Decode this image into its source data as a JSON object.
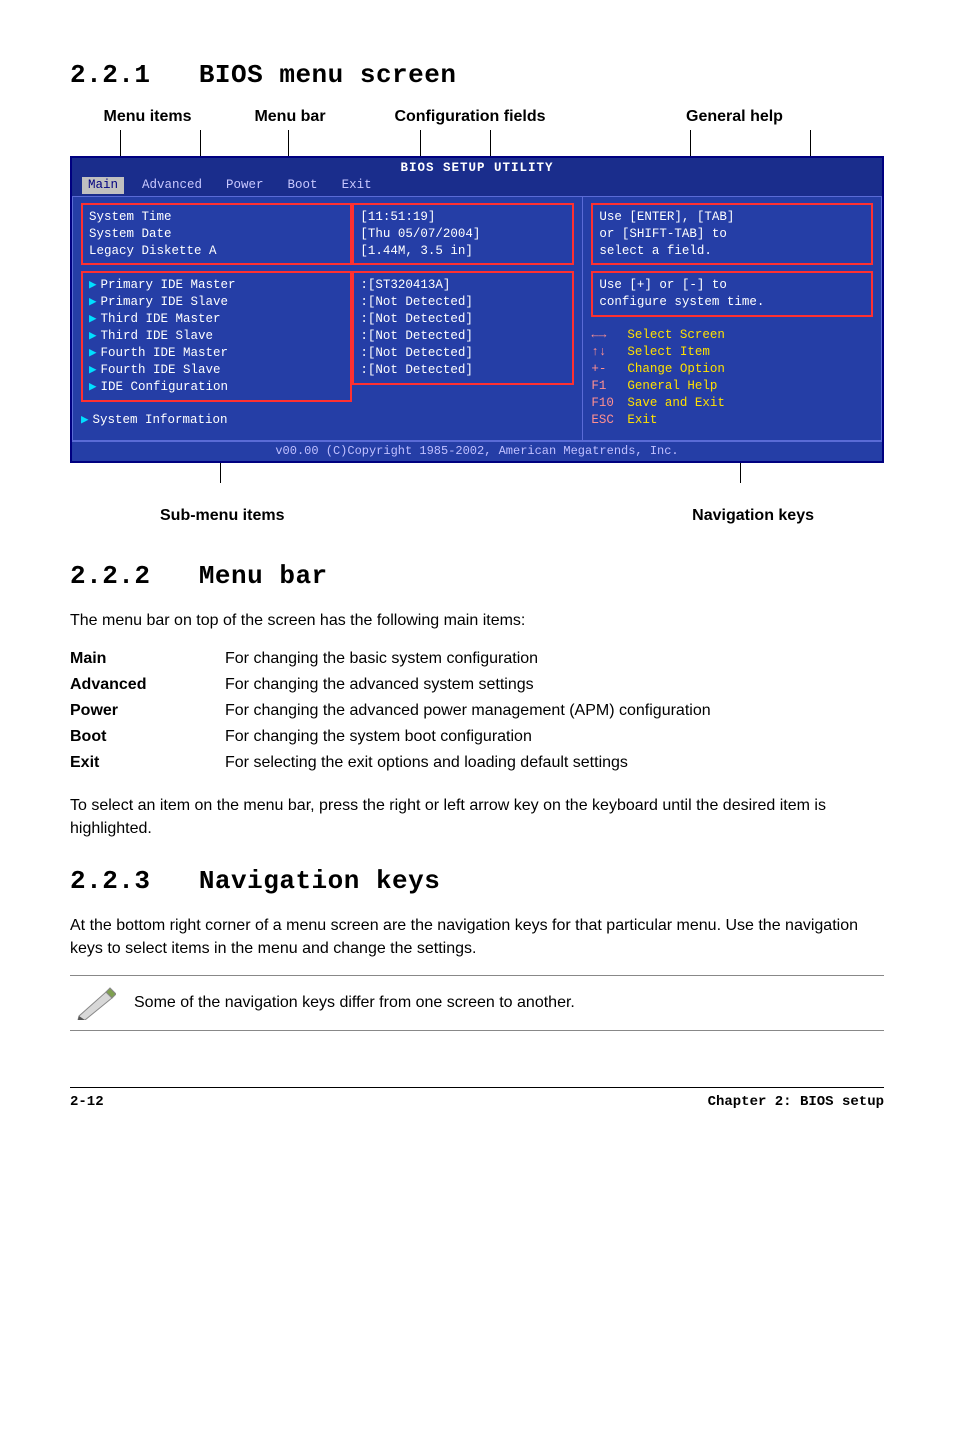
{
  "sections": {
    "s1": {
      "num": "2.2.1",
      "title": "BIOS menu screen"
    },
    "s2": {
      "num": "2.2.2",
      "title": "Menu bar"
    },
    "s3": {
      "num": "2.2.3",
      "title": "Navigation keys"
    }
  },
  "annot": {
    "menu_items": "Menu items",
    "menu_bar": "Menu bar",
    "config_fields": "Configuration fields",
    "general_help": "General help",
    "sub_menu": "Sub-menu items",
    "nav_keys": "Navigation keys"
  },
  "bios": {
    "title": "BIOS SETUP UTILITY",
    "tabs": {
      "main": "Main",
      "advanced": "Advanced",
      "power": "Power",
      "boot": "Boot",
      "exit": "Exit"
    },
    "left": {
      "sys_time": "System Time",
      "sys_date": "System Date",
      "legacy": "Legacy Diskette A",
      "p_master": "Primary IDE Master",
      "p_slave": "Primary IDE Slave",
      "t_master": "Third IDE Master",
      "t_slave": "Third IDE Slave",
      "f_master": "Fourth IDE Master",
      "f_slave": "Fourth IDE Slave",
      "ide_cfg": "IDE Configuration",
      "sys_info": "System Information"
    },
    "values": {
      "time": "[11:51:19]",
      "date": "[Thu 05/07/2004]",
      "disk": "[1.44M, 3.5 in]",
      "pm": ":[ST320413A]",
      "ps": ":[Not Detected]",
      "tm": ":[Not Detected]",
      "ts": ":[Not Detected]",
      "fm": ":[Not Detected]",
      "fs": ":[Not Detected]"
    },
    "help": {
      "l1": "Use [ENTER], [TAB]",
      "l2": "or [SHIFT-TAB] to",
      "l3": "select a field.",
      "l4": "Use [+] or [-] to",
      "l5": "configure system time."
    },
    "nav": {
      "k1": "←→",
      "a1": "Select Screen",
      "k2": "↑↓",
      "a2": "Select Item",
      "k3": "+-",
      "a3": "Change Option",
      "k4": "F1",
      "a4": "General Help",
      "k5": "F10",
      "a5": "Save and Exit",
      "k6": "ESC",
      "a6": "Exit"
    },
    "footer": "v00.00 (C)Copyright 1985-2002, American Megatrends, Inc."
  },
  "menubar_intro": "The menu bar on top of the screen has the following main items:",
  "defs": {
    "main": {
      "term": "Main",
      "desc": "For changing the basic system configuration"
    },
    "advanced": {
      "term": "Advanced",
      "desc": "For changing the advanced system settings"
    },
    "power": {
      "term": "Power",
      "desc": "For changing the advanced power management (APM) configuration"
    },
    "boot": {
      "term": "Boot",
      "desc": "For changing the system boot configuration"
    },
    "exit": {
      "term": "Exit",
      "desc": "For selecting the exit options and loading default settings"
    }
  },
  "menubar_outro": "To select an item on the menu bar, press the right or left arrow key on the keyboard until the desired item is highlighted.",
  "navkeys_text": "At the bottom right corner of a menu screen are the navigation keys for that particular menu. Use the navigation keys to select items in the menu and change the settings.",
  "note": "Some of the navigation keys differ from one screen to another.",
  "footer": {
    "page": "2-12",
    "chapter": "Chapter 2: BIOS setup"
  }
}
